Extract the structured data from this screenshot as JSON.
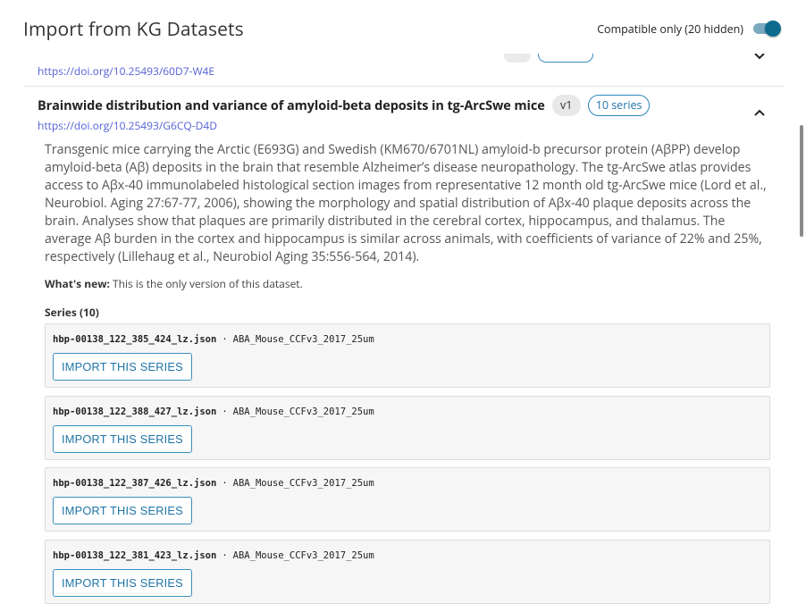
{
  "dialog": {
    "title": "Import from KG Datasets",
    "toggle_label": "Compatible only (20 hidden)",
    "toggle_on": true
  },
  "previous_item": {
    "doi": "https://doi.org/10.25493/60D7-W4E"
  },
  "dataset": {
    "title": "Brainwide distribution and variance of amyloid-beta deposits in tg-ArcSwe mice",
    "version": "v1",
    "series_count": "10 series",
    "doi": "https://doi.org/10.25493/G6CQ-D4D",
    "description": "Transgenic mice carrying the Arctic (E693G) and Swedish (KM670/6701NL) amyloid-b precursor protein (AβPP) develop amyloid-beta (Aβ) deposits in the brain that resemble Alzheimer’s disease neuropathology. The tg-ArcSwe atlas provides access to Aβx-40 immunolabeled histological section images from representative 12 month old tg-ArcSwe mice (Lord et al., Neurobiol. Aging 27:67-77, 2006), showing the morphology and spatial distribution of Aβx-40 plaque deposits across the brain. Analyses show that plaques are primarily distributed in the cerebral cortex, hippocampus, and thalamus. The average Aβ burden in the cortex and hippocampus is similar across animals, with coefficients of variance of 22% and 25%, respectively (Lillehaug et al., Neurobiol Aging 35:556-564, 2014).",
    "whats_new_label": "What's new:",
    "whats_new_text": "This is the only version of this dataset.",
    "series_heading": "Series (10)",
    "series": [
      {
        "file": "hbp-00138_122_385_424_lz.json",
        "separator": "·",
        "atlas": "ABA_Mouse_CCFv3_2017_25um",
        "button": "IMPORT THIS SERIES"
      },
      {
        "file": "hbp-00138_122_388_427_lz.json",
        "separator": "·",
        "atlas": "ABA_Mouse_CCFv3_2017_25um",
        "button": "IMPORT THIS SERIES"
      },
      {
        "file": "hbp-00138_122_387_426_lz.json",
        "separator": "·",
        "atlas": "ABA_Mouse_CCFv3_2017_25um",
        "button": "IMPORT THIS SERIES"
      },
      {
        "file": "hbp-00138_122_381_423_lz.json",
        "separator": "·",
        "atlas": "ABA_Mouse_CCFv3_2017_25um",
        "button": "IMPORT THIS SERIES"
      }
    ]
  },
  "icons": {
    "expand": "chevron-down-icon",
    "collapse": "chevron-up-icon"
  },
  "colors": {
    "accent": "#1f75a8",
    "link": "#5563d6",
    "toggle_knob": "#0e6a8f"
  }
}
